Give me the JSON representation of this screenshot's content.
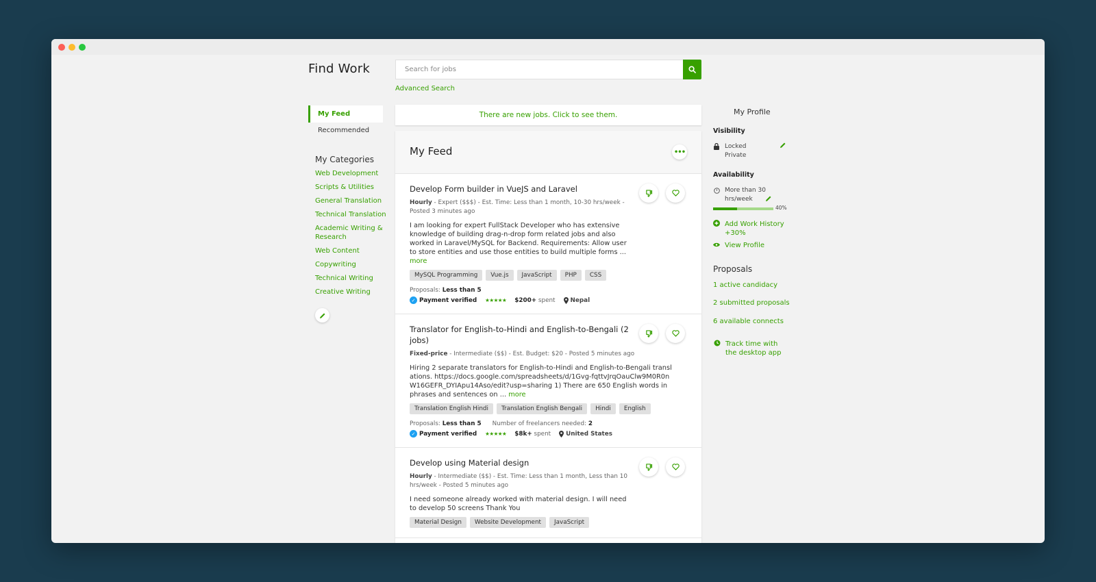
{
  "header": {
    "title": "Find Work",
    "search_placeholder": "Search for jobs",
    "advanced_search": "Advanced Search"
  },
  "nav": {
    "feed": "My Feed",
    "recommended": "Recommended"
  },
  "categories": {
    "title": "My Categories",
    "items": [
      "Web Development",
      "Scripts & Utilities",
      "General Translation",
      "Technical Translation",
      "Academic Writing & Research",
      "Web Content",
      "Copywriting",
      "Technical Writing",
      "Creative Writing"
    ]
  },
  "feed": {
    "banner": "There are new jobs. Click to see them.",
    "title": "My Feed",
    "jobs": [
      {
        "title": "Develop Form builder in VueJS and Laravel",
        "type": "Hourly",
        "meta": " - Expert ($$$) - Est. Time: Less than 1 month, 10-30 hrs/week - Posted 3 minutes ago",
        "desc": "I am looking for expert FullStack Developer who has extensive knowledge of building drag-n-drop form related jobs and also worked in Laravel/MySQL for Backend. Requirements: Allow user to store entities and use those entities to build multiple forms ...",
        "more": "more",
        "tags": [
          "MySQL Programming",
          "Vue.js",
          "JavaScript",
          "PHP",
          "CSS"
        ],
        "proposals_label": "Proposals: ",
        "proposals": "Less than 5",
        "verified": "Payment verified",
        "spent_amount": "$200+",
        "spent_label": " spent",
        "location": "Nepal"
      },
      {
        "title": "Translator for English-to-Hindi and English-to-Bengali (2 jobs)",
        "type": "Fixed-price",
        "meta": " - Intermediate ($$) - Est. Budget: $20 - Posted 5 minutes ago",
        "desc": "Hiring 2 separate translators for English-to-Hindi and English-to-Bengali translations. https://docs.google.com/spreadsheets/d/1Gvg-fqttvJrqOauClw9M0R0nW16GEFR_DYIApu14Aso/edit?usp=sharing 1) There are 650 English words in phrases and sentences on ...",
        "more": "more",
        "tags": [
          "Translation English Hindi",
          "Translation English Bengali",
          "Hindi",
          "English"
        ],
        "proposals_label": "Proposals: ",
        "proposals": "Less than 5",
        "freelancers_label": "Number of freelancers needed: ",
        "freelancers": "2",
        "verified": "Payment verified",
        "spent_amount": "$8k+",
        "spent_label": " spent",
        "location": "United States"
      },
      {
        "title": "Develop using Material design",
        "type": "Hourly",
        "meta": " - Intermediate ($$) - Est. Time: Less than 1 month, Less than 10 hrs/week - Posted 5 minutes ago",
        "desc": "I need someone already worked with material design. I will need to develop 50 screens Thank You",
        "tags": [
          "Material Design",
          "Website Development",
          "JavaScript"
        ]
      }
    ]
  },
  "profile": {
    "title": "My Profile",
    "visibility_label": "Visibility",
    "visibility_lock": "Locked",
    "visibility_value": "Private",
    "availability_label": "Availability",
    "availability_value": "More than 30 hrs/week",
    "completeness": 0.4,
    "completeness_text": "40%",
    "add_history": "Add Work History +30%",
    "view_profile": "View Profile",
    "proposals_title": "Proposals",
    "active": "1 active candidacy",
    "submitted": "2 submitted proposals",
    "connects": "6 available connects",
    "track_time": "Track time with the desktop app"
  },
  "colors": {
    "accent": "#37a000",
    "background": "#1a3c4e",
    "verified": "#1da1f2"
  }
}
